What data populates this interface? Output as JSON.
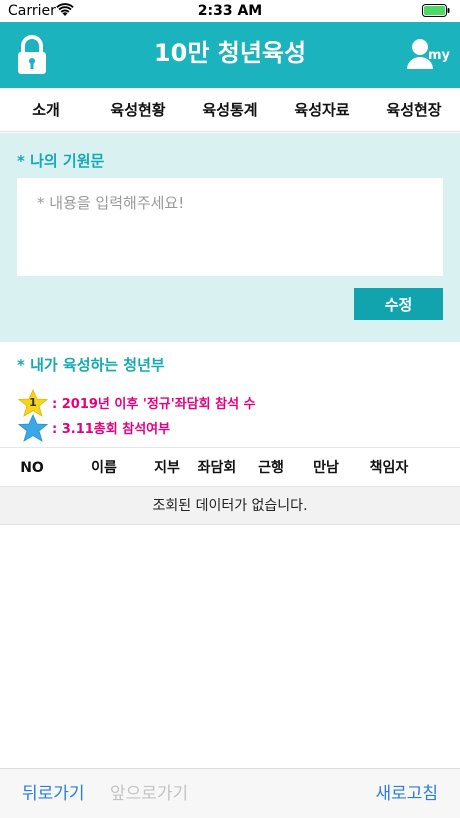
{
  "status_bar": {
    "carrier": "Carrier",
    "time": "2:33 AM"
  },
  "header": {
    "title": "10만 청년육성",
    "my_label": "my",
    "left_icon": "lock-icon",
    "right_icon": "user-icon",
    "brand_color": "#1bb3bd"
  },
  "tabs": [
    {
      "label": "소개"
    },
    {
      "label": "육성현황"
    },
    {
      "label": "육성통계"
    },
    {
      "label": "육성자료"
    },
    {
      "label": "육성현장"
    }
  ],
  "prayer": {
    "title": "* 나의 기원문",
    "placeholder": "* 내용을 입력해주세요!",
    "value": "",
    "edit_label": "수정"
  },
  "mentee": {
    "title": "* 내가 육성하는 청년부",
    "legend": [
      {
        "icon": "star-icon-yellow",
        "badge": "1",
        "text": ": 2019년 이후 '정규'좌담회 참석 수",
        "color": "#e6007e"
      },
      {
        "icon": "star-icon-blue",
        "badge": "",
        "text": ": 3.11총회 참석여부",
        "color": "#e6007e"
      }
    ]
  },
  "table": {
    "columns": [
      "NO",
      "이름",
      "지부",
      "좌담회",
      "근행",
      "만남",
      "책임자"
    ],
    "empty_message": "조회된 데이터가 없습니다."
  },
  "bottom_nav": {
    "back": "뒤로가기",
    "forward": "앞으로가기",
    "refresh": "새로고침"
  }
}
